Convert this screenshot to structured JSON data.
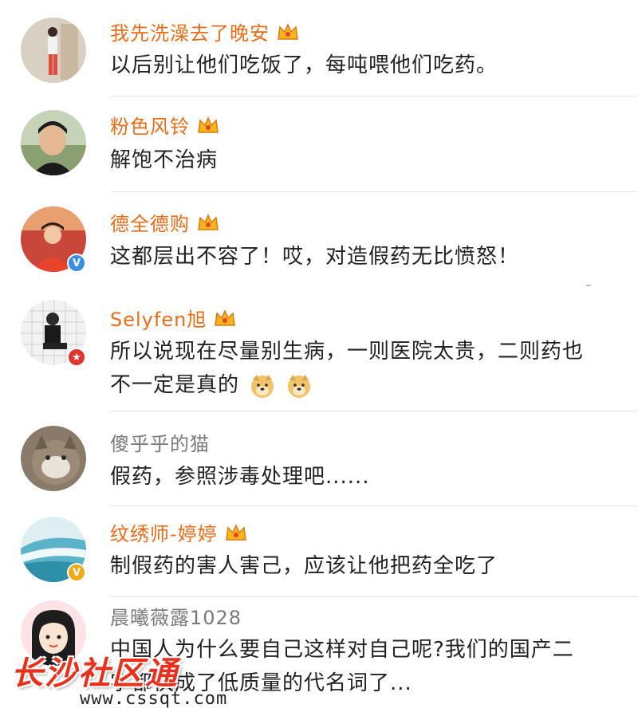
{
  "colors": {
    "vip_name": "#e96d19",
    "plain_name": "#7a7a7a",
    "text": "#222222",
    "watermark": "#e8301c"
  },
  "comments": [
    {
      "username": "我先洗澡去了晚安",
      "vip": true,
      "badge": "",
      "text": "以后别让他们吃饭了，每吨喂他们吃药。",
      "avatar": "woman-standing-avatar"
    },
    {
      "username": "粉色风铃",
      "vip": true,
      "badge": "",
      "text": "解饱不治病",
      "avatar": "man-portrait-avatar"
    },
    {
      "username": "德全德购",
      "vip": true,
      "badge": "V",
      "text": "这都层出不容了！哎，对造假药无比愤怒！",
      "avatar": "woman-red-coat-avatar"
    },
    {
      "username": "Selyfen旭",
      "vip": true,
      "badge": "★",
      "text_line1": "所以说现在尽量别生病，一则医院太贵，二则药也",
      "text_line2": "不一定是真的",
      "emoji": "doge-emoji",
      "avatar": "man-sitting-avatar"
    },
    {
      "username": "傻乎乎的猫",
      "vip": false,
      "badge": "",
      "text": "假药，参照涉毒处理吧......",
      "avatar": "cat-avatar"
    },
    {
      "username": "纹绣师-婷婷",
      "vip": true,
      "badge": "V",
      "text": "制假药的害人害己，应该让他把药全吃了",
      "avatar": "beach-avatar"
    },
    {
      "username": "晨曦薇露1028",
      "vip": false,
      "badge": "",
      "text_line1": "中国人为什么要自己这样对自己呢?我们的国产二",
      "text_line2": "字都快成了低质量的代名词了...",
      "avatar": "cartoon-girl-avatar"
    }
  ],
  "watermark": {
    "title": "长沙社区通",
    "url": "www.cssqt.com"
  }
}
